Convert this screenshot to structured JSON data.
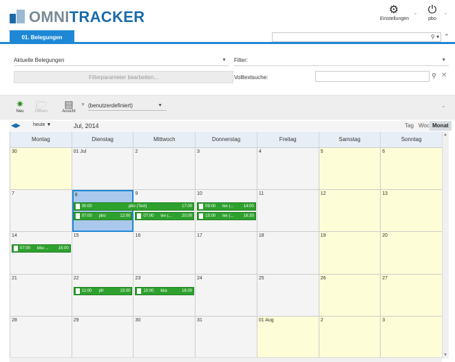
{
  "header": {
    "logo_omni": "OMNI",
    "logo_tracker": "TRACKER",
    "settings_label": "Einstellungen",
    "user_label": "pbo"
  },
  "tabs": {
    "active_label": "01. Belegungen"
  },
  "filters": {
    "view_select": "Aktuelle Belegungen",
    "filter_label": "Filter:",
    "edit_params_label": "Filterparameter bearbeiten...",
    "fulltext_label": "Volltextsuche:",
    "fulltext_value": ""
  },
  "toolbar": {
    "new_label": "Neu",
    "open_label": "Öffnen",
    "view_label": "Ansicht",
    "view_select": "(benutzerdefiniert)"
  },
  "calendar": {
    "today_label": "heute",
    "month_label": "Jul, 2014",
    "view_day": "Tag",
    "view_week": "Woche",
    "view_month": "Monat",
    "weekdays": [
      "Montag",
      "Dienstag",
      "Mittwoch",
      "Donnerstag",
      "Freitag",
      "Samstag",
      "Sonntag"
    ],
    "weeks": [
      [
        "30",
        "01 Jul",
        "2",
        "3",
        "4",
        "5",
        "6"
      ],
      [
        "7",
        "8",
        "9",
        "10",
        "11",
        "12",
        "13"
      ],
      [
        "14",
        "15",
        "16",
        "17",
        "18",
        "19",
        "20"
      ],
      [
        "21",
        "22",
        "23",
        "24",
        "25",
        "26",
        "27"
      ],
      [
        "28",
        "29",
        "30",
        "31",
        "01 Aug",
        "2",
        "3"
      ]
    ],
    "events": [
      {
        "week": 1,
        "day": 1,
        "slot": 0,
        "start": "00:00",
        "title": "pbo (Test)",
        "end": "17:00",
        "span": 2
      },
      {
        "week": 1,
        "day": 1,
        "slot": 1,
        "start": "07:00",
        "title": "pbo",
        "end": "12:00",
        "span": 1
      },
      {
        "week": 1,
        "day": 2,
        "slot": 1,
        "start": "07:00",
        "title": "lex (...",
        "end": "20:00",
        "span": 1
      },
      {
        "week": 1,
        "day": 3,
        "slot": 0,
        "start": "09:00",
        "title": "lex (...",
        "end": "14:00",
        "span": 1
      },
      {
        "week": 1,
        "day": 3,
        "slot": 1,
        "start": "15:00",
        "title": "lex (...",
        "end": "16:30",
        "span": 1
      },
      {
        "week": 2,
        "day": 0,
        "slot": 0,
        "start": "07:00",
        "title": "bbu ...",
        "end": "15:00",
        "span": 1
      },
      {
        "week": 3,
        "day": 1,
        "slot": 0,
        "start": "11:00",
        "title": "pfr",
        "end": "15:00",
        "span": 1
      },
      {
        "week": 3,
        "day": 2,
        "slot": 0,
        "start": "10:00",
        "title": "kka",
        "end": "16:00",
        "span": 1
      }
    ]
  }
}
